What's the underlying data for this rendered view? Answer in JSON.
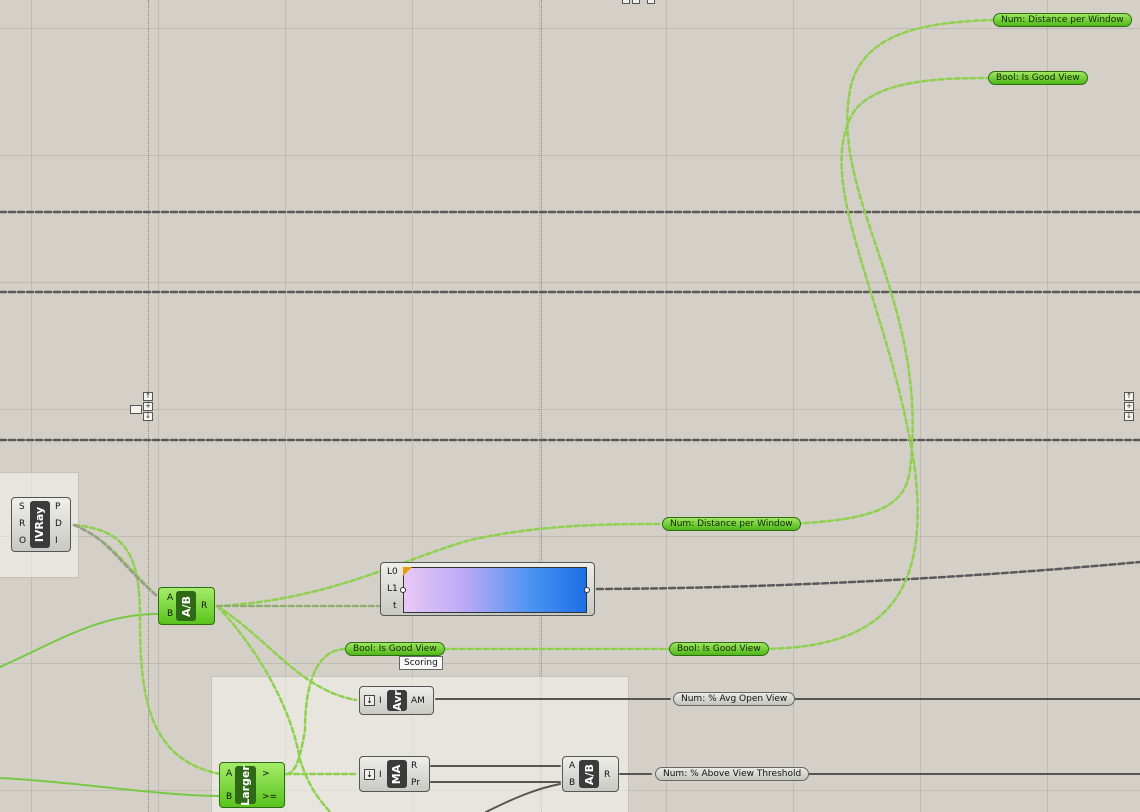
{
  "components": {
    "ivray": {
      "label": "IVRay",
      "inputs": [
        "S",
        "R",
        "O"
      ],
      "outputs": [
        "P",
        "D",
        "I"
      ]
    },
    "divide_top": {
      "label": "A/B",
      "inputs": [
        "A",
        "B"
      ],
      "outputs": [
        "R"
      ]
    },
    "gradient": {
      "inputs": [
        "L0",
        "L1",
        "t"
      ]
    },
    "average": {
      "label": "Avr",
      "inputs": [
        "I"
      ],
      "outputs": [
        "AM"
      ]
    },
    "larger": {
      "label": "Larger",
      "inputs": [
        "A",
        "B"
      ],
      "outputs": [
        ">",
        ">="
      ]
    },
    "mass_addition": {
      "label": "MA",
      "inputs": [
        "I"
      ],
      "outputs": [
        "R",
        "Pr"
      ]
    },
    "divide_bottom": {
      "label": "A/B",
      "inputs": [
        "A",
        "B"
      ],
      "outputs": [
        "R"
      ]
    }
  },
  "relays": {
    "num_distance_top": "Num: Distance per Window",
    "bool_good_view_top": "Bool: Is Good View",
    "num_distance_mid": "Num: Distance per Window",
    "bool_good_view_left": "Bool: Is Good View",
    "bool_good_view_right": "Bool: Is Good View",
    "num_avg_open_view": "Num: % Avg Open View",
    "num_above_threshold": "Num: % Above View Threshold"
  },
  "tooltip": "Scoring",
  "colors": {
    "canvas": "#d4d0c8",
    "wire_selected": "#8fd14f",
    "wire_normal": "#555555",
    "component_green": "#58c41c",
    "component_grey": "#c9c9c4"
  }
}
